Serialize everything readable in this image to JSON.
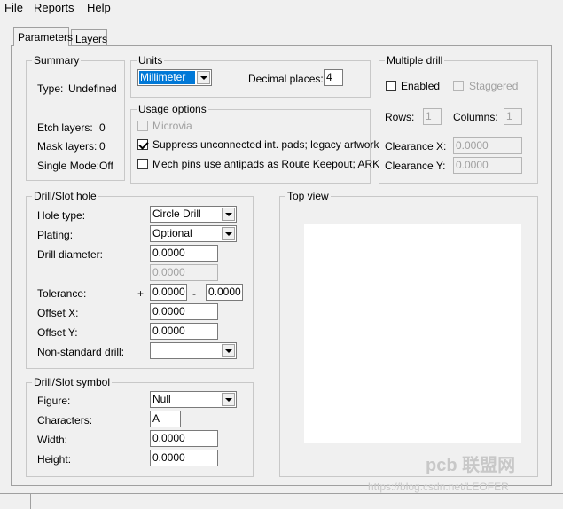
{
  "menu": {
    "file": "File",
    "reports": "Reports",
    "help": "Help"
  },
  "tabs": {
    "parameters": "Parameters",
    "layers": "Layers"
  },
  "summary": {
    "title": "Summary",
    "type_label": "Type:",
    "type_value": "Undefined",
    "etch_label": "Etch layers:",
    "etch_value": "0",
    "mask_label": "Mask layers:",
    "mask_value": "0",
    "single_label": "Single Mode:",
    "single_value": "Off"
  },
  "units": {
    "title": "Units",
    "unit_value": "Millimeter",
    "decimal_label": "Decimal places:",
    "decimal_value": "4"
  },
  "usage": {
    "title": "Usage options",
    "microvia": "Microvia",
    "suppress": "Suppress unconnected int. pads; legacy artwork",
    "mech": "Mech pins use antipads as Route Keepout; ARK"
  },
  "multi": {
    "title": "Multiple drill",
    "enabled": "Enabled",
    "staggered": "Staggered",
    "rows_label": "Rows:",
    "rows_value": "1",
    "cols_label": "Columns:",
    "cols_value": "1",
    "clx_label": "Clearance X:",
    "clx_value": "0.0000",
    "cly_label": "Clearance Y:",
    "cly_value": "0.0000"
  },
  "drill": {
    "title": "Drill/Slot hole",
    "hole_label": "Hole type:",
    "hole_value": "Circle Drill",
    "plating_label": "Plating:",
    "plating_value": "Optional",
    "diam_label": "Drill diameter:",
    "diam_value": "0.0000",
    "diam2_value": "0.0000",
    "tol_label": "Tolerance:",
    "plus": "+",
    "tol_plus": "0.0000",
    "minus": "-",
    "tol_minus": "0.0000",
    "offx_label": "Offset X:",
    "offx_value": "0.0000",
    "offy_label": "Offset Y:",
    "offy_value": "0.0000",
    "nonstd_label": "Non-standard drill:",
    "nonstd_value": ""
  },
  "symbol": {
    "title": "Drill/Slot symbol",
    "figure_label": "Figure:",
    "figure_value": "Null",
    "chars_label": "Characters:",
    "chars_value": "A",
    "width_label": "Width:",
    "width_value": "0.0000",
    "height_label": "Height:",
    "height_value": "0.0000"
  },
  "topview": {
    "title": "Top view"
  },
  "watermark": {
    "line1": "pcb 联盟网",
    "line2": "https://blog.csdn.net/LEOFER"
  }
}
